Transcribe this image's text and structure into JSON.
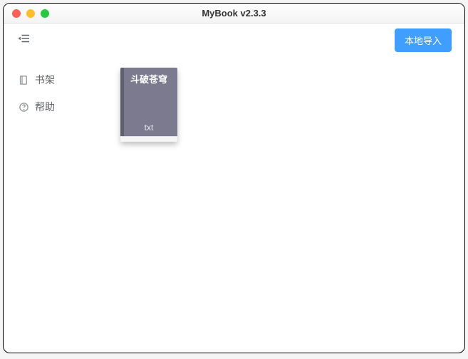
{
  "window": {
    "title": "MyBook v2.3.3"
  },
  "topbar": {
    "import_label": "本地导入"
  },
  "sidebar": {
    "items": [
      {
        "label": "书架"
      },
      {
        "label": "帮助"
      }
    ]
  },
  "books": [
    {
      "title": "斗破苍穹",
      "format": "txt"
    }
  ],
  "colors": {
    "accent": "#409eff",
    "book_cover": "#7b7a8e"
  }
}
